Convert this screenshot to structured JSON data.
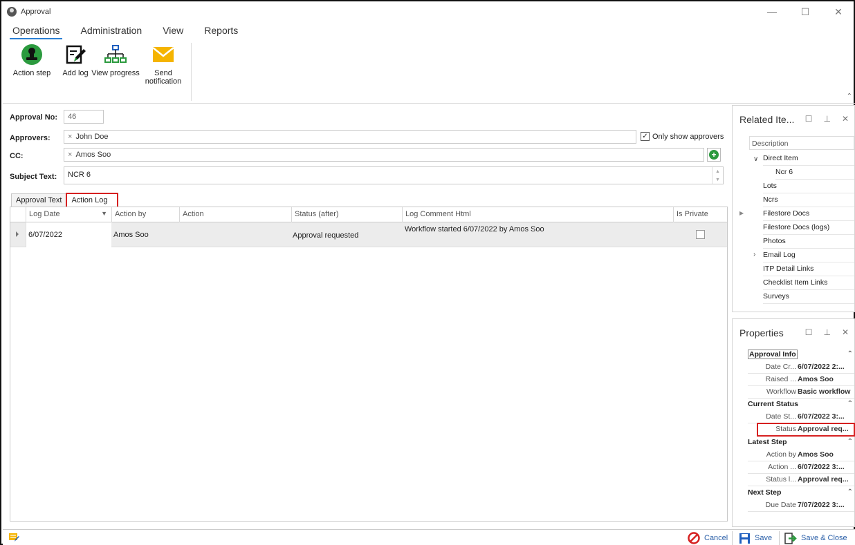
{
  "window": {
    "title": "Approval"
  },
  "menu": {
    "tabs": [
      "Operations",
      "Administration",
      "View",
      "Reports"
    ]
  },
  "ribbon": {
    "action_step": "Action step",
    "add_log": "Add log",
    "view_progress": "View progress",
    "send_notification_1": "Send",
    "send_notification_2": "notification"
  },
  "form": {
    "approval_no_label": "Approval No:",
    "approval_no_value": "46",
    "approvers_label": "Approvers:",
    "approvers_token": "John  Doe",
    "only_show_approvers": "Only show approvers",
    "cc_label": "CC:",
    "cc_token": "Amos Soo",
    "subject_label": "Subject Text:",
    "subject_value": "NCR 6"
  },
  "tabs": [
    "Approval Text",
    "Action Log"
  ],
  "grid": {
    "columns": [
      "Log Date",
      "Action by",
      "Action",
      "Status (after)",
      "Log Comment Html",
      "Is Private"
    ],
    "rows": [
      {
        "log_date": "6/07/2022",
        "action_by": "Amos Soo",
        "action": "",
        "status_after": "Approval requested",
        "comment": "Workflow started 6/07/2022 by Amos Soo"
      }
    ]
  },
  "related": {
    "title": "Related Ite...",
    "header": "Description",
    "items": [
      "Direct Item",
      "Ncr 6",
      "Lots",
      "Ncrs",
      "Filestore Docs",
      "Filestore Docs (logs)",
      "Photos",
      "Email Log",
      "ITP Detail Links",
      "Checklist Item Links",
      "Surveys"
    ]
  },
  "properties": {
    "title": "Properties",
    "categories": {
      "approval_info": "Approval Info",
      "current_status": "Current Status",
      "latest_step": "Latest Step",
      "next_step": "Next Step"
    },
    "rows": {
      "date_created_name": "Date Cr...",
      "date_created_val": "6/07/2022 2:...",
      "raised_name": "Raised ...",
      "raised_val": "Amos Soo",
      "workflow_name": "Workflow",
      "workflow_val": "Basic workflow",
      "date_status_name": "Date St...",
      "date_status_val": "6/07/2022 3:...",
      "status_name": "Status",
      "status_val": "Approval req...",
      "action_by_name": "Action by",
      "action_by_val": "Amos Soo",
      "action_date_name": "Action ...",
      "action_date_val": "6/07/2022 3:...",
      "status_l_name": "Status l...",
      "status_l_val": "Approval req...",
      "due_date_name": "Due Date",
      "due_date_val": "7/07/2022 3:..."
    }
  },
  "status_bar": {
    "cancel": "Cancel",
    "save": "Save",
    "save_close": "Save & Close"
  },
  "colors": {
    "accent": "#2a7fd4",
    "highlight": "#d62020",
    "add_green": "#2b9a3e"
  }
}
